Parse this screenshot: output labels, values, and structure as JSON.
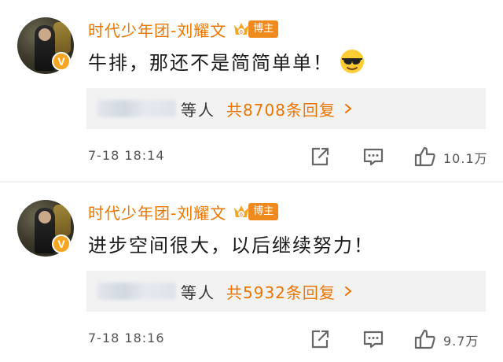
{
  "comments": [
    {
      "username": "时代少年团-刘耀文",
      "host_badge": "博主",
      "text": "牛排，那还不是简简单单！",
      "emoji": "sunglasses-emoji",
      "reply_suffix": "等人",
      "reply_count": "共8708条回复",
      "time": "7-18 18:14",
      "likes": "10.1万"
    },
    {
      "username": "时代少年团-刘耀文",
      "host_badge": "博主",
      "text": "进步空间很大，以后继续努力！",
      "reply_suffix": "等人",
      "reply_count": "共5932条回复",
      "time": "7-18 18:16",
      "likes": "9.7万"
    }
  ],
  "colors": {
    "name": "#ea7500",
    "badge": "#f08a1c",
    "verified": "#f5a623",
    "reply_box": "#f2f2f2"
  }
}
